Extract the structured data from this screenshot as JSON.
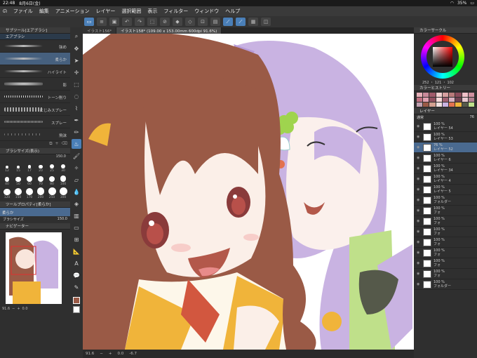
{
  "status": {
    "time": "22:48",
    "date": "8月6日(金)",
    "battery": "35%"
  },
  "menu": [
    "ファイル",
    "編集",
    "アニメーション",
    "レイヤー",
    "選択範囲",
    "表示",
    "フィルター",
    "ウィンドウ",
    "ヘルプ"
  ],
  "tabs": [
    "イラスト156*",
    "イラスト158* (109.00 x 153.00mm 600dpi 91.6%)"
  ],
  "sub_tool": {
    "title": "サブツール[エアブラシ]",
    "group": "エアブラシ",
    "brushes": [
      "強め",
      "柔らか",
      "ハイライト",
      "影",
      "トーン削り",
      "にじみスプレー",
      "スプレー",
      "飛沫"
    ]
  },
  "brush_size": {
    "title": "ブラシサイズ(表示)",
    "top_value": "150.0",
    "values": [
      "12",
      "15",
      "17",
      "20",
      "25",
      "30",
      "40",
      "50",
      "60",
      "70",
      "80",
      "100",
      "120",
      "150",
      "170",
      "200",
      "250",
      "300"
    ]
  },
  "tool_property": {
    "title": "ツールプロパティ[柔らか]",
    "label": "柔らか",
    "sub": "ブラシサイズ",
    "value": "150.0"
  },
  "navigator": {
    "title": "ナビゲーター",
    "zoom": "91.6",
    "angle": "0.0"
  },
  "bottom": {
    "zoom": "91.6",
    "angle": "0.0",
    "angle2": "-6.7"
  },
  "color_circle": {
    "title": "カラーサークル",
    "values": "252 ・ 121 ・ 102"
  },
  "color_history": {
    "title": "カラーヒストリー"
  },
  "layer_panel": {
    "title": "レイヤー",
    "blend": "通常",
    "opacity": "76"
  },
  "layers": [
    {
      "pct": "100 %",
      "mode": "通常",
      "name": "レイヤー 54"
    },
    {
      "pct": "100 %",
      "mode": "通常",
      "name": "レイヤー 53"
    },
    {
      "pct": "76 %",
      "mode": "通常",
      "name": "レイヤー 52"
    },
    {
      "pct": "100 %",
      "mode": "通常",
      "name": "レイヤー 6"
    },
    {
      "pct": "100 %",
      "mode": "通常",
      "name": "レイヤー 34"
    },
    {
      "pct": "100 %",
      "mode": "通常",
      "name": "レイヤー 4"
    },
    {
      "pct": "100 %",
      "mode": "通常",
      "name": "レイヤー 5"
    },
    {
      "pct": "100 %",
      "mode": "",
      "name": "フォルダー"
    },
    {
      "pct": "100 %",
      "mode": "",
      "name": "フォ"
    },
    {
      "pct": "100 %",
      "mode": "",
      "name": "フォ"
    },
    {
      "pct": "100 %",
      "mode": "",
      "name": "フォ"
    },
    {
      "pct": "100 %",
      "mode": "",
      "name": "フォ"
    },
    {
      "pct": "100 %",
      "mode": "",
      "name": "フォ"
    },
    {
      "pct": "100 %",
      "mode": "",
      "name": "フォ"
    },
    {
      "pct": "100 %",
      "mode": "",
      "name": "フォ"
    },
    {
      "pct": "100 %",
      "mode": "",
      "name": "フォルダー"
    }
  ],
  "colors": {
    "accent": "#4a7fb8",
    "hair_brown": "#9a5a46",
    "hair_purple": "#c9b3e2",
    "vest": "#f0b43a"
  }
}
